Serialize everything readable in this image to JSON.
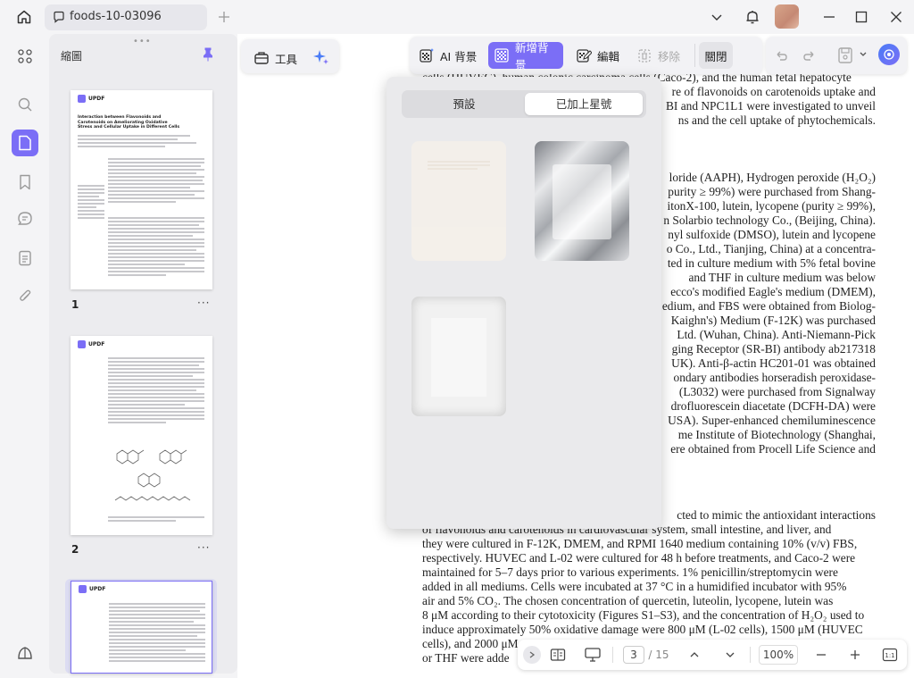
{
  "window": {
    "tab_title": "foods-10-03096",
    "icons": [
      "home-icon",
      "tab-doc-icon",
      "new-tab-icon",
      "chevron-down-icon",
      "bell-icon",
      "avatar",
      "minimize-icon",
      "maximize-icon",
      "close-icon"
    ]
  },
  "left_rail": {
    "icons": [
      "grid-icon",
      "search-icon",
      "page-icon",
      "bookmark-icon",
      "comment-icon",
      "attachment-icon",
      "signature-icon",
      "layers-icon"
    ]
  },
  "thumbnails": {
    "title": "縮圖",
    "pages": [
      {
        "num": "1",
        "more": "···",
        "heading": "Interaction between Flavonoids and Carotenoids on Ameliorating Oxidative Stress and Cellular Uptake in Different Cells",
        "logo": "UPDF"
      },
      {
        "num": "2",
        "more": "···",
        "logo": "UPDF"
      },
      {
        "num": "3",
        "more": "···",
        "logo": "UPDF"
      }
    ]
  },
  "toolbar": {
    "tools_label": "工具",
    "ai_bg_label": "AI 背景",
    "add_bg_label": "新增背景",
    "edit_label": "編輯",
    "remove_label": "移除",
    "close_label": "關閉"
  },
  "popup": {
    "tab_default": "預設",
    "tab_starred": "已加上星號"
  },
  "document_lines": [
    "ls (HUVEC)                   s (qu",
    "                              umb",
    "cells (HUVEC), human colonic carcinoma cells (Caco-2), and the human fetal hepatocyte",
    "                          re of flavonoids on carotenoids uptake and",
    "                          BI and NPC1L1 were investigated to unveil",
    "                          ns and the cell uptake of phytochemicals.",
    "                          loride (AAPH), Hydrogen peroxide (H₂O₂)",
    "                          purity ≥ 99%) were purchased from Shang-",
    "                          itonX-100, lutein, lycopene (purity ≥ 99%),",
    "                          n Solarbio technology Co., (Beijing, China).",
    "                          nyl sulfoxide (DMSO), lutein and lycopene",
    "                          o Co., Ltd., Tianjing, China) at a concentra-",
    "                          ted in culture medium with 5% fetal bovine",
    "                          and THF in culture medium was below",
    "                          ecco's modified Eagle's medium (DMEM),",
    "                          edium, and FBS were obtained from Biolog-",
    "                          Kaighn's) Medium (F-12K) was purchased",
    "                          Ltd. (Wuhan, China). Anti-Niemann-Pick",
    "                          ging Receptor (SR-BI) antibody ab217318",
    "                          UK). Anti-β-actin HC201-01 was obtained",
    "                          ondary antibodies horseradish peroxidase-",
    "                          (L3032) were purchased from Signalway",
    "                          drofluorescein diacetate (DCFH-DA) were",
    "                          USA). Super-enhanced chemiluminescence",
    "                          me Institute of Biotechnology (Shanghai,",
    "                          ere obtained from Procell Life Science and",
    "                          cted to mimic the antioxidant interactions",
    "of flavonoids and carotenoids in cardiovascular system, small intestine, and liver, and",
    "they were cultured in F-12K, DMEM, and RPMI 1640 medium containing 10% (v/v) FBS,",
    "respectively. HUVEC and L-02 were cultured for 48 h before treatments, and Caco-2 were",
    "maintained for 5–7 days prior to various experiments. 1% penicillin/streptomycin were",
    "added in all mediums. Cells were incubated at 37 °C in a humidified incubator with 95%",
    "air and 5% CO₂. The chosen concentration of quercetin, luteolin, lycopene, lutein was",
    "8 μM according to their cytotoxicity (Figures S1–S3), and the concentration of H₂O₂ used to",
    "induce approximately 50% oxidative damage were 800 μM (L-02 cells), 1500 μM (HUVEC",
    "cells), and 2000 μM                                                   ",
    "or THF were adde"
  ],
  "bottombar": {
    "page_current": "3",
    "page_total": "/ 15",
    "zoom": "100%"
  },
  "colors": {
    "accent": "#7b6ef6",
    "panel": "#ececef",
    "bg": "#f4f4f6"
  }
}
